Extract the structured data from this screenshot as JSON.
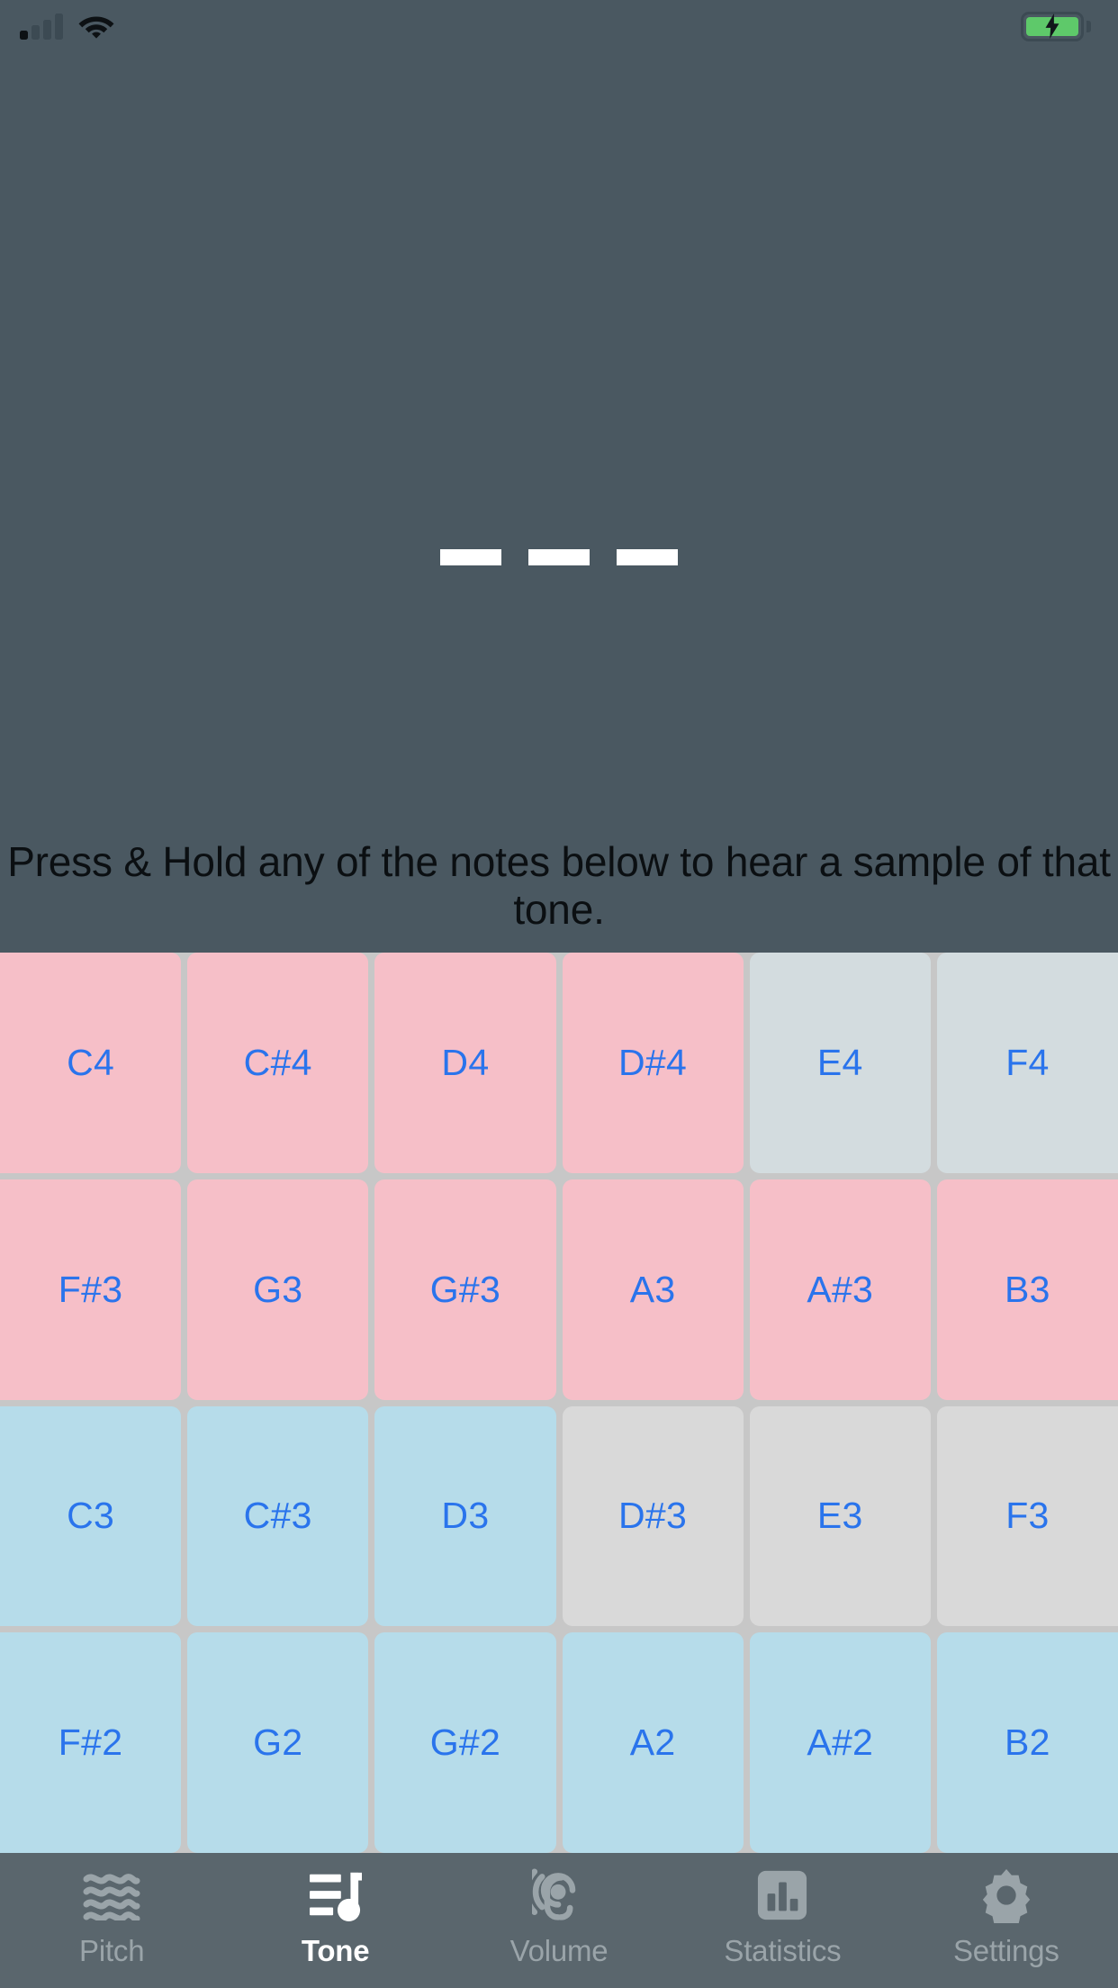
{
  "status_bar": {
    "signal_icon": "cellular-signal-icon",
    "wifi_icon": "wifi-icon",
    "battery_icon": "battery-charging-icon",
    "battery_charging": true
  },
  "hero": {
    "placeholder_icon": "loading-dashes-indicator",
    "dash_count": 3
  },
  "instruction": {
    "text": "Press & Hold any of the notes below to hear a sample of that tone."
  },
  "note_grid": {
    "columns": 6,
    "rows": 4,
    "tiles": [
      {
        "label": "C4",
        "state": "pink"
      },
      {
        "label": "C#4",
        "state": "pink"
      },
      {
        "label": "D4",
        "state": "pink"
      },
      {
        "label": "D#4",
        "state": "pink"
      },
      {
        "label": "E4",
        "state": "slate"
      },
      {
        "label": "F4",
        "state": "slate"
      },
      {
        "label": "F#3",
        "state": "pink"
      },
      {
        "label": "G3",
        "state": "pink"
      },
      {
        "label": "G#3",
        "state": "pink"
      },
      {
        "label": "A3",
        "state": "pink"
      },
      {
        "label": "A#3",
        "state": "pink"
      },
      {
        "label": "B3",
        "state": "pink"
      },
      {
        "label": "C3",
        "state": "blue"
      },
      {
        "label": "C#3",
        "state": "blue"
      },
      {
        "label": "D3",
        "state": "blue"
      },
      {
        "label": "D#3",
        "state": "gray"
      },
      {
        "label": "E3",
        "state": "gray"
      },
      {
        "label": "F3",
        "state": "gray"
      },
      {
        "label": "F#2",
        "state": "blue"
      },
      {
        "label": "G2",
        "state": "blue"
      },
      {
        "label": "G#2",
        "state": "blue"
      },
      {
        "label": "A2",
        "state": "blue"
      },
      {
        "label": "A#2",
        "state": "blue"
      },
      {
        "label": "B2",
        "state": "blue"
      }
    ]
  },
  "tab_bar": {
    "items": [
      {
        "label": "Pitch",
        "icon": "waves-icon",
        "active": false
      },
      {
        "label": "Tone",
        "icon": "music-note-icon",
        "active": true
      },
      {
        "label": "Volume",
        "icon": "ear-icon",
        "active": false
      },
      {
        "label": "Statistics",
        "icon": "bar-chart-icon",
        "active": false
      },
      {
        "label": "Settings",
        "icon": "gear-icon",
        "active": false
      }
    ]
  },
  "colors": {
    "background": "#4a5861",
    "tabbar_background": "#5a666d",
    "grid_gap": "#c7c7c7",
    "note_text": "#2a74ec",
    "tile_pink": "#f6bfc8",
    "tile_blue": "#b6dcea",
    "tile_slate": "#d3dcdf",
    "tile_gray": "#d9d9d9",
    "tab_active": "#ffffff",
    "tab_inactive": "#9aa4a9",
    "battery_green": "#5ec96a"
  }
}
